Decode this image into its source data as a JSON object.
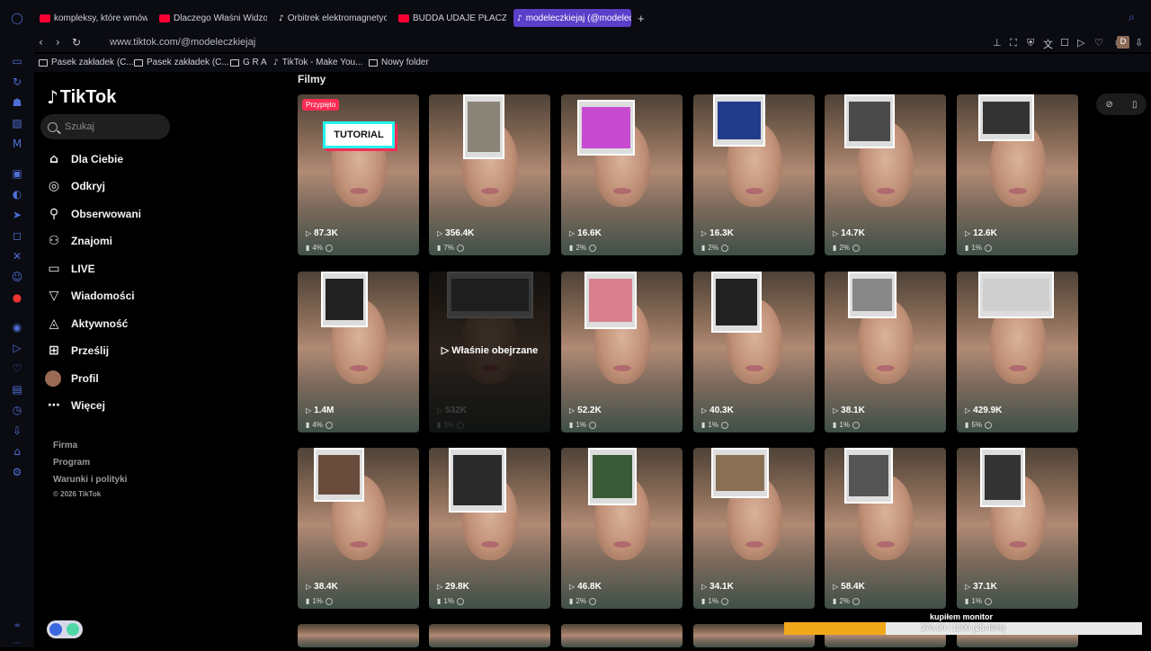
{
  "browser": {
    "tabs": [
      {
        "label": "kompleksy, które wmówiły",
        "favicon_color": "#ff0033",
        "active": false
      },
      {
        "label": "Dlaczego Właśni Widzowie",
        "favicon_color": "#ff0033",
        "active": false
      },
      {
        "label": "Orbitrek elektromagnetyczny",
        "favicon_color": "#ffffff",
        "active": false
      },
      {
        "label": "BUDDA UDAJE PŁACZ I W",
        "favicon_color": "#ff0033",
        "active": false
      },
      {
        "label": "modeleczkiejaj (@modelec",
        "favicon_color": "#ffffff",
        "active": true
      }
    ],
    "new_tab_label": "+",
    "url": "www.tiktok.com/@modeleczkiejaj",
    "bookmarks": [
      {
        "label": "Pasek zakładek (C...",
        "icon": "folder-icon"
      },
      {
        "label": "Pasek zakładek (C...",
        "icon": "folder-icon"
      },
      {
        "label": "G R A",
        "icon": "folder-icon"
      },
      {
        "label": "TikTok - Make You...",
        "icon": "tiktok-icon"
      },
      {
        "label": "Nowy folder",
        "icon": "folder-icon"
      }
    ],
    "profile_initial": "D"
  },
  "sidebar": {
    "logo": "TikTok",
    "search_placeholder": "Szukaj",
    "nav": [
      {
        "label": "Dla Ciebie",
        "icon": "home-icon"
      },
      {
        "label": "Odkryj",
        "icon": "compass-icon"
      },
      {
        "label": "Obserwowani",
        "icon": "following-icon"
      },
      {
        "label": "Znajomi",
        "icon": "friends-icon"
      },
      {
        "label": "LIVE",
        "icon": "live-icon"
      },
      {
        "label": "Wiadomości",
        "icon": "messages-icon"
      },
      {
        "label": "Aktywność",
        "icon": "activity-icon"
      },
      {
        "label": "Prześlij",
        "icon": "upload-icon"
      },
      {
        "label": "Profil",
        "icon": "avatar"
      },
      {
        "label": "Więcej",
        "icon": "more-icon"
      }
    ],
    "footer": [
      "Firma",
      "Program",
      "Warunki i polityki",
      "© 2026 TikTok"
    ]
  },
  "main": {
    "section_title": "Filmy",
    "pinned_label": "Przypięto",
    "tutorial_label": "TUTORIAL",
    "watched_label": "Właśnie obejrzane",
    "videos": [
      {
        "views": "87.3K",
        "stat": "4%"
      },
      {
        "views": "356.4K",
        "stat": "7%"
      },
      {
        "views": "16.6K",
        "stat": "2%"
      },
      {
        "views": "16.3K",
        "stat": "2%"
      },
      {
        "views": "14.7K",
        "stat": "2%"
      },
      {
        "views": "12.6K",
        "stat": "1%"
      },
      {
        "views": "1.4M",
        "stat": "4%"
      },
      {
        "views": "532K",
        "stat": "3%"
      },
      {
        "views": "52.2K",
        "stat": "1%"
      },
      {
        "views": "40.3K",
        "stat": "1%"
      },
      {
        "views": "38.1K",
        "stat": "1%"
      },
      {
        "views": "429.9K",
        "stat": "5%"
      },
      {
        "views": "38.4K",
        "stat": "1%"
      },
      {
        "views": "29.8K",
        "stat": "1%"
      },
      {
        "views": "46.8K",
        "stat": "2%"
      },
      {
        "views": "34.1K",
        "stat": "1%"
      },
      {
        "views": "58.4K",
        "stat": "2%"
      },
      {
        "views": "37.1K",
        "stat": "1%"
      }
    ]
  },
  "overlay": {
    "monitor_label": "kupiłem monitor",
    "monitor_progress_text": "370.00 / 1300 (28.46%)",
    "monitor_progress": 0.2846
  },
  "colors": {
    "accent_tab": "#5a3fc9",
    "tiktok_pink": "#fe2c55",
    "tiktok_cyan": "#25f4ee",
    "progress": "#f0a81a"
  }
}
